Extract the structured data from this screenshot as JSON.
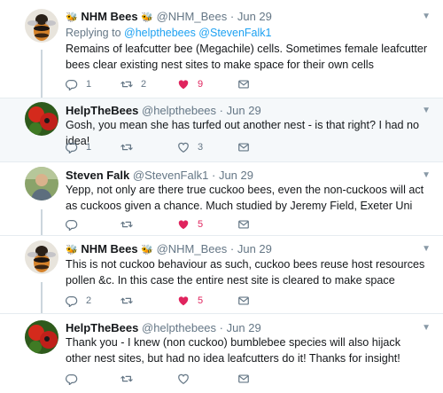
{
  "tweets": [
    {
      "author": "NHM Bees",
      "handle": "@NHM_Bees",
      "date": "Jun 29",
      "replying_prefix": "Replying to",
      "replying_handles": "@helpthebees @StevenFalk1",
      "text": "Remains of leafcutter bee (Megachile) cells. Sometimes female leafcutter bees clear existing nest sites to make space for their own cells",
      "replies": "1",
      "retweets": "2",
      "likes": "9",
      "liked": true
    },
    {
      "author": "HelpTheBees",
      "handle": "@helpthebees",
      "date": "Jun 29",
      "text": "Gosh, you mean she has turfed out another nest - is that right?  I had no idea!",
      "replies": "1",
      "retweets": "",
      "likes": "3",
      "liked": false
    },
    {
      "author": "Steven Falk",
      "handle": "@StevenFalk1",
      "date": "Jun 29",
      "text": "Yepp, not only are there true cuckoo bees, even the non-cuckoos will act as cuckoos given a chance. Much studied by Jeremy Field, Exeter Uni",
      "replies": "",
      "retweets": "",
      "likes": "5",
      "liked": true
    },
    {
      "author": "NHM Bees",
      "handle": "@NHM_Bees",
      "date": "Jun 29",
      "text": "This is not cuckoo behaviour as such, cuckoo bees reuse host resources pollen &c. In this case the entire nest site is cleared to make space",
      "replies": "2",
      "retweets": "",
      "likes": "5",
      "liked": true
    },
    {
      "author": "HelpTheBees",
      "handle": "@helpthebees",
      "date": "Jun 29",
      "text": "Thank you - I knew (non cuckoo) bumblebee species will also hijack other nest sites, but had no idea leafcutters do it! Thanks for insight!",
      "replies": "",
      "retweets": "",
      "likes": "",
      "liked": false
    }
  ],
  "icons": {
    "reply": "reply-icon",
    "retweet": "retweet-icon",
    "like": "heart-icon",
    "message": "envelope-icon",
    "more": "chevron-down-icon",
    "bee": "bee-emoji-icon"
  },
  "colors": {
    "accent": "#1da1f2",
    "like": "#e0245e",
    "muted": "#657786",
    "highlight_bg": "#f5f8fa"
  },
  "punct": {
    "dot": "·"
  }
}
